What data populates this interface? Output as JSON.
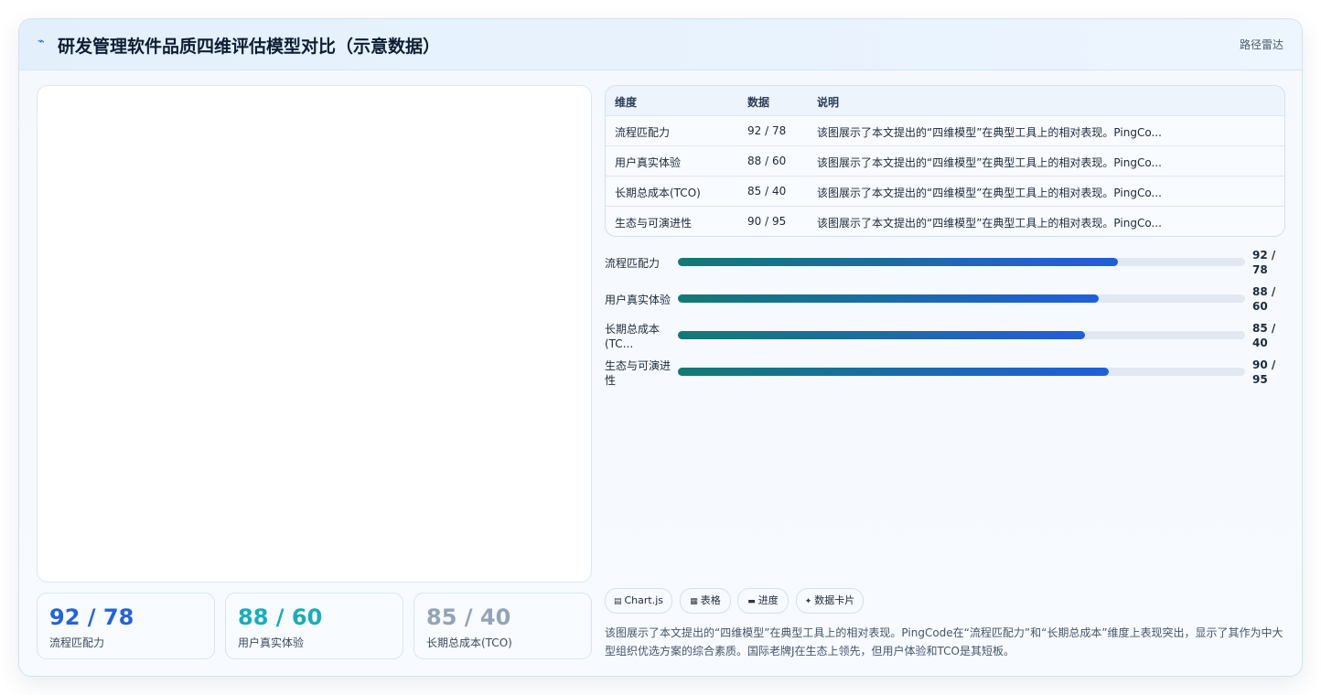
{
  "header": {
    "icon": "trend-line-icon",
    "title": "研发管理软件品质四维评估模型对比（示意数据）",
    "right_label": "路径雷达"
  },
  "kpis": [
    {
      "value": "92 / 78",
      "label": "流程匹配力",
      "color": "#2563d9"
    },
    {
      "value": "88 / 60",
      "label": "用户真实体验",
      "color": "#17aeb8"
    },
    {
      "value": "85 / 40",
      "label": "长期总成本(TCO)",
      "color": "#94a3b8"
    }
  ],
  "table": {
    "headers": [
      "维度",
      "数据",
      "说明"
    ],
    "rows": [
      {
        "dimension": "流程匹配力",
        "data": "92 / 78",
        "note": "该图展示了本文提出的“四维模型”在典型工具上的相对表现。PingCo..."
      },
      {
        "dimension": "用户真实体验",
        "data": "88 / 60",
        "note": "该图展示了本文提出的“四维模型”在典型工具上的相对表现。PingCo..."
      },
      {
        "dimension": "长期总成本(TCO)",
        "data": "85 / 40",
        "note": "该图展示了本文提出的“四维模型”在典型工具上的相对表现。PingCo..."
      },
      {
        "dimension": "生态与可演进性",
        "data": "90 / 95",
        "note": "该图展示了本文提出的“四维模型”在典型工具上的相对表现。PingCo..."
      }
    ]
  },
  "progress": [
    {
      "label": "流程匹配力",
      "value_text": "92 / 78",
      "fraction": 0.776
    },
    {
      "label": "用户真实体验",
      "value_text": "88 / 60",
      "fraction": 0.742
    },
    {
      "label": "长期总成本(TC...",
      "value_text": "85 / 40",
      "fraction": 0.717
    },
    {
      "label": "生态与可演进性",
      "value_text": "90 / 95",
      "fraction": 0.759
    }
  ],
  "chips": [
    {
      "icon": "chart-icon",
      "glyph": "▤",
      "label": "Chart.js"
    },
    {
      "icon": "table-icon",
      "glyph": "▦",
      "label": "表格"
    },
    {
      "icon": "progress-icon",
      "glyph": "▬",
      "label": "进度"
    },
    {
      "icon": "sparkle-icon",
      "glyph": "✦",
      "label": "数据卡片"
    }
  ],
  "description": "该图展示了本文提出的“四维模型”在典型工具上的相对表现。PingCode在“流程匹配力”和“长期总成本”维度上表现突出，显示了其作为中大型组织优选方案的综合素质。国际老牌J在生态上领先，但用户体验和TCO是其短板。"
}
